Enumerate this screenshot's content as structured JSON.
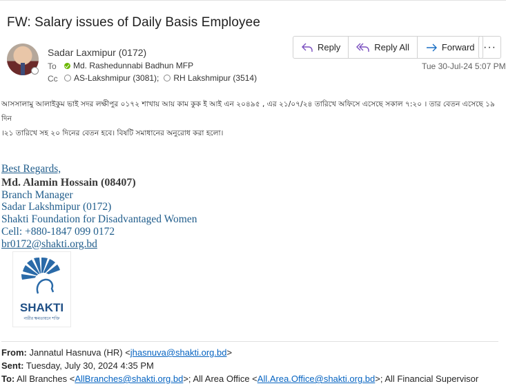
{
  "subject": "FW: Salary issues of Daily Basis Employee",
  "header": {
    "sender": "Sadar Laxmipur (0172)",
    "to_label": "To",
    "to": "Md. Rashedunnabi Badhun MFP",
    "cc_label": "Cc",
    "cc": [
      "AS-Lakshmipur (3081);",
      "RH Lakshmipur (3514)"
    ],
    "date": "Tue 30-Jul-24 5:07 PM"
  },
  "actions": {
    "reply": "Reply",
    "reply_all": "Reply All",
    "forward": "Forward",
    "more": "···"
  },
  "body": {
    "line1": "আসসালামু আলাইকুম ভাই সদর লক্ষীপুর ০১৭২ শাখায় আয় কাম কুক ই আই এন ২০৪৯৫ , এর ২১/০৭/২৪ তারিখে অফিসে এসেছে সকাল ৭:২০ । তার বেতন এসেছে ১৯ দিন",
    "line2": "।২১ তারিখে সহ ২০ দিনের বেতন হবে। বিষটি সমাধানের অনুরোধ করা হলো।"
  },
  "signature": {
    "regards": "Best Regards,",
    "name": "Md. Alamin Hossain (08407)",
    "title": "Branch Manager",
    "branch": "Sadar Lakshmipur (0172)",
    "org": "Shakti Foundation for Disadvantaged Women",
    "cell": "Cell: +880-1847 099 0172",
    "email": "br0172@shakti.org.bd",
    "logo_text": "SHAKTI",
    "logo_sub": "নারীর ক্ষমতায়নে শক্তি"
  },
  "forwarded": {
    "from_label": "From:",
    "from_name": "Jannatul Hasnuva (HR) <",
    "from_email": "jhasnuva@shakti.org.bd",
    "from_end": ">",
    "sent_label": "Sent:",
    "sent": "Tuesday, July 30, 2024 4:35 PM",
    "to_label": "To:",
    "to_prefix": "All Branches <",
    "to_email1": "AllBranches@shakti.org.bd",
    "to_mid": ">; All Area Office <",
    "to_email2": "All.Area.Office@shakti.org.bd",
    "to_suffix": ">; All Financial Supervisor"
  }
}
